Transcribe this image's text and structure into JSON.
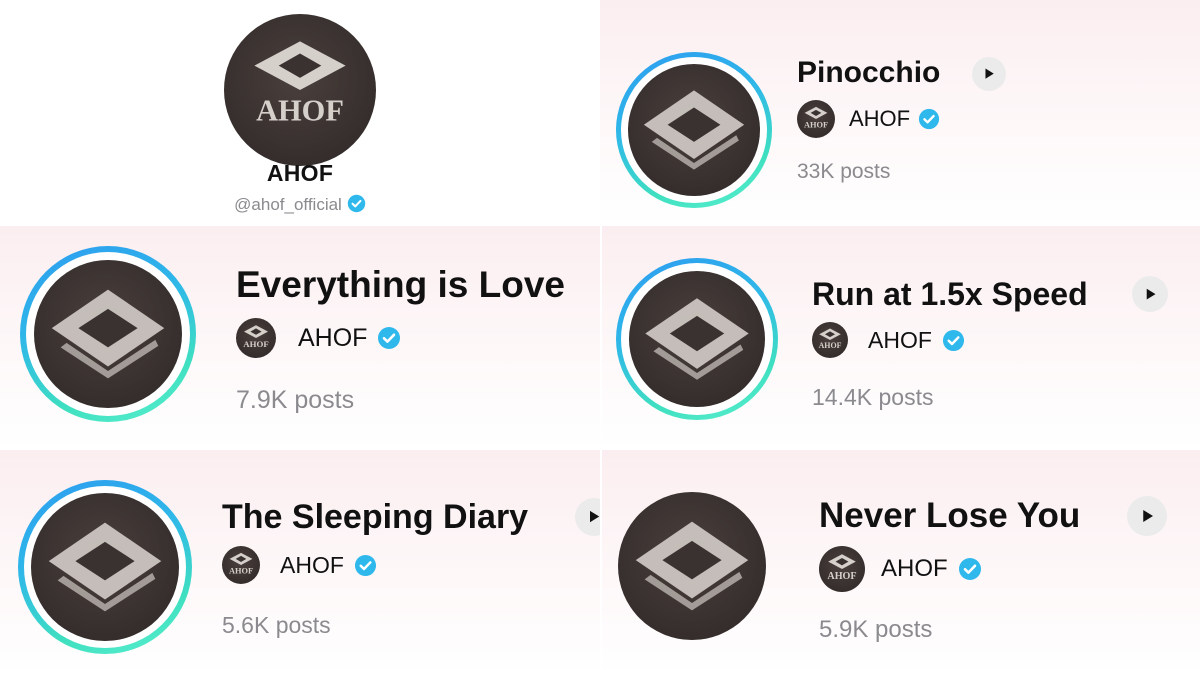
{
  "profile": {
    "avatar_text": "AHOF",
    "name": "AHOF",
    "handle": "@ahof_official"
  },
  "songs": [
    {
      "title": "Pinocchio",
      "artist": "AHOF",
      "posts": "33K posts"
    },
    {
      "title": "Everything is Love",
      "artist": "AHOF",
      "posts": "7.9K posts"
    },
    {
      "title": "Run at 1.5x Speed",
      "artist": "AHOF",
      "posts": "14.4K posts"
    },
    {
      "title": "The Sleeping Diary",
      "artist": "AHOF",
      "posts": "5.6K posts"
    },
    {
      "title": "Never Lose You",
      "artist": "AHOF",
      "posts": "5.9K posts"
    }
  ],
  "mini_avatar_text": "AHOF",
  "colors": {
    "verified": "#2fb8ec",
    "ring_start": "#2d9cf0",
    "ring_end": "#5af0d0",
    "muted_text": "#8a8a8f",
    "play_button_bg": "#ebebeb"
  },
  "icons": {
    "play": "play-icon",
    "verified": "verified-badge-icon"
  }
}
